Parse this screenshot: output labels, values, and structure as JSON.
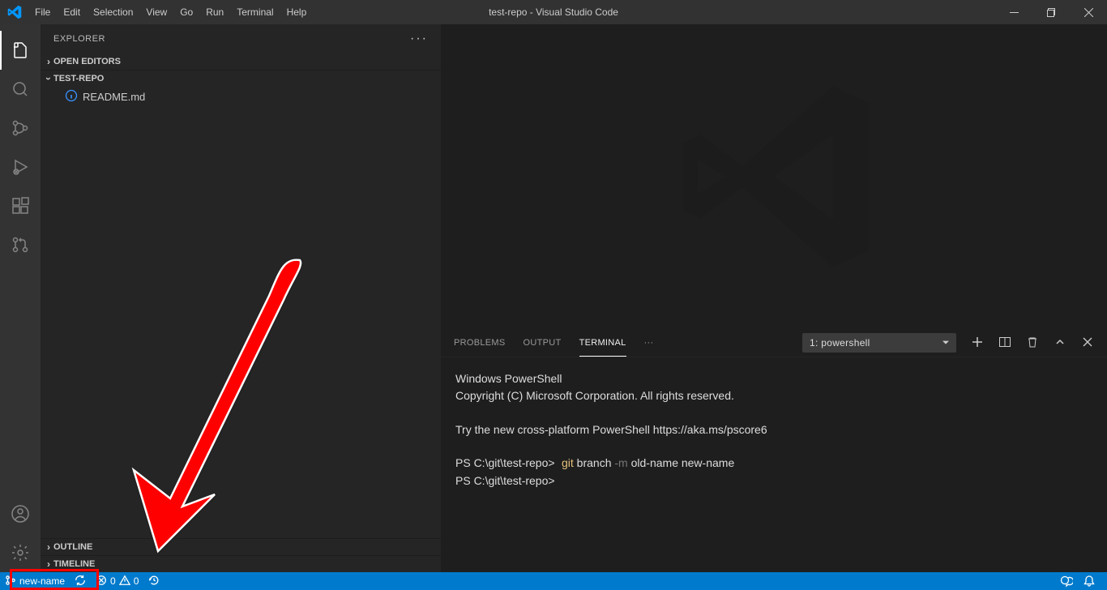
{
  "title": "test-repo - Visual Studio Code",
  "menus": [
    "File",
    "Edit",
    "Selection",
    "View",
    "Go",
    "Run",
    "Terminal",
    "Help"
  ],
  "explorer": {
    "title": "EXPLORER",
    "openEditors": "OPEN EDITORS",
    "folder": "TEST-REPO",
    "files": [
      {
        "name": "README.md"
      }
    ],
    "outline": "OUTLINE",
    "timeline": "TIMELINE"
  },
  "panel": {
    "tabs": {
      "problems": "PROBLEMS",
      "output": "OUTPUT",
      "terminal": "TERMINAL"
    },
    "termSelect": "1: powershell",
    "terminal": {
      "line1": "Windows PowerShell",
      "line2": "Copyright (C) Microsoft Corporation. All rights reserved.",
      "line3": "Try the new cross-platform PowerShell https://aka.ms/pscore6",
      "prompt1": "PS C:\\git\\test-repo>",
      "cmdGit": "git",
      "cmdRest": " branch ",
      "cmdFlag": "-m",
      "cmdArgs": " old-name new-name",
      "prompt2": "PS C:\\git\\test-repo>"
    }
  },
  "statusbar": {
    "branch": "new-name",
    "errors": "0",
    "warnings": "0"
  }
}
